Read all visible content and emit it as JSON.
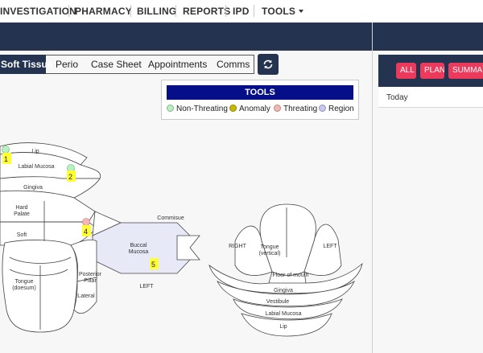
{
  "topnav": {
    "investigation": "INVESTIGATION",
    "pharmacy": "PHARMACY",
    "billing": "BILLING",
    "reports": "REPORTS",
    "ipd": "IPD",
    "tools": "TOOLS"
  },
  "tabs": {
    "soft_tissue": "Soft Tissue",
    "perio": "Perio",
    "case_sheet": "Case Sheet",
    "appointments": "Appointments",
    "comms": "Comms"
  },
  "tools_panel": {
    "title": "TOOLS",
    "legend": {
      "non_threating": "Non-Threating",
      "anomaly": "Anomaly",
      "threating": "Threating",
      "region": "Region"
    }
  },
  "right_panel": {
    "buttons": {
      "all": "ALL",
      "plan": "PLAN",
      "summary": "SUMMARY"
    },
    "today": "Today"
  },
  "diagram_left": {
    "lip": "Lip",
    "labial_mucosa": "Labial Mucosa",
    "gingiva": "Gingiva",
    "hard_palate": "Hard Palate",
    "soft": "Soft",
    "commisue": "Commisue",
    "buccal_mucosa": "Buccal Mucosa",
    "left": "LEFT",
    "tongue_dorsum": "Tongue (doesum)",
    "posterior_pillar": "Posterior Pillar",
    "lateral": "Lateral",
    "markers": [
      "1",
      "2",
      "4",
      "5"
    ]
  },
  "diagram_right": {
    "right": "RIGHT",
    "left": "LEFT",
    "tongue_vertical": "Tongue (vertical)",
    "floor_of_mouth": "Floor of mouth",
    "gingiva": "Gingiva",
    "vestibule": "Vestibule",
    "labial_mucosa": "Labial Mucosa",
    "lip": "Lip"
  },
  "colors": {
    "nav": "#233350",
    "tools_title": "#050f87",
    "pill": "#ec3a5d",
    "non_threating": "#b8f0c0",
    "anomaly": "#c8b800",
    "threating": "#f5b7b1",
    "region": "#c5c8f5",
    "marker": "#ffff33"
  },
  "icons": {
    "refresh": "refresh-icon",
    "tools_caret": "caret-down-icon"
  }
}
